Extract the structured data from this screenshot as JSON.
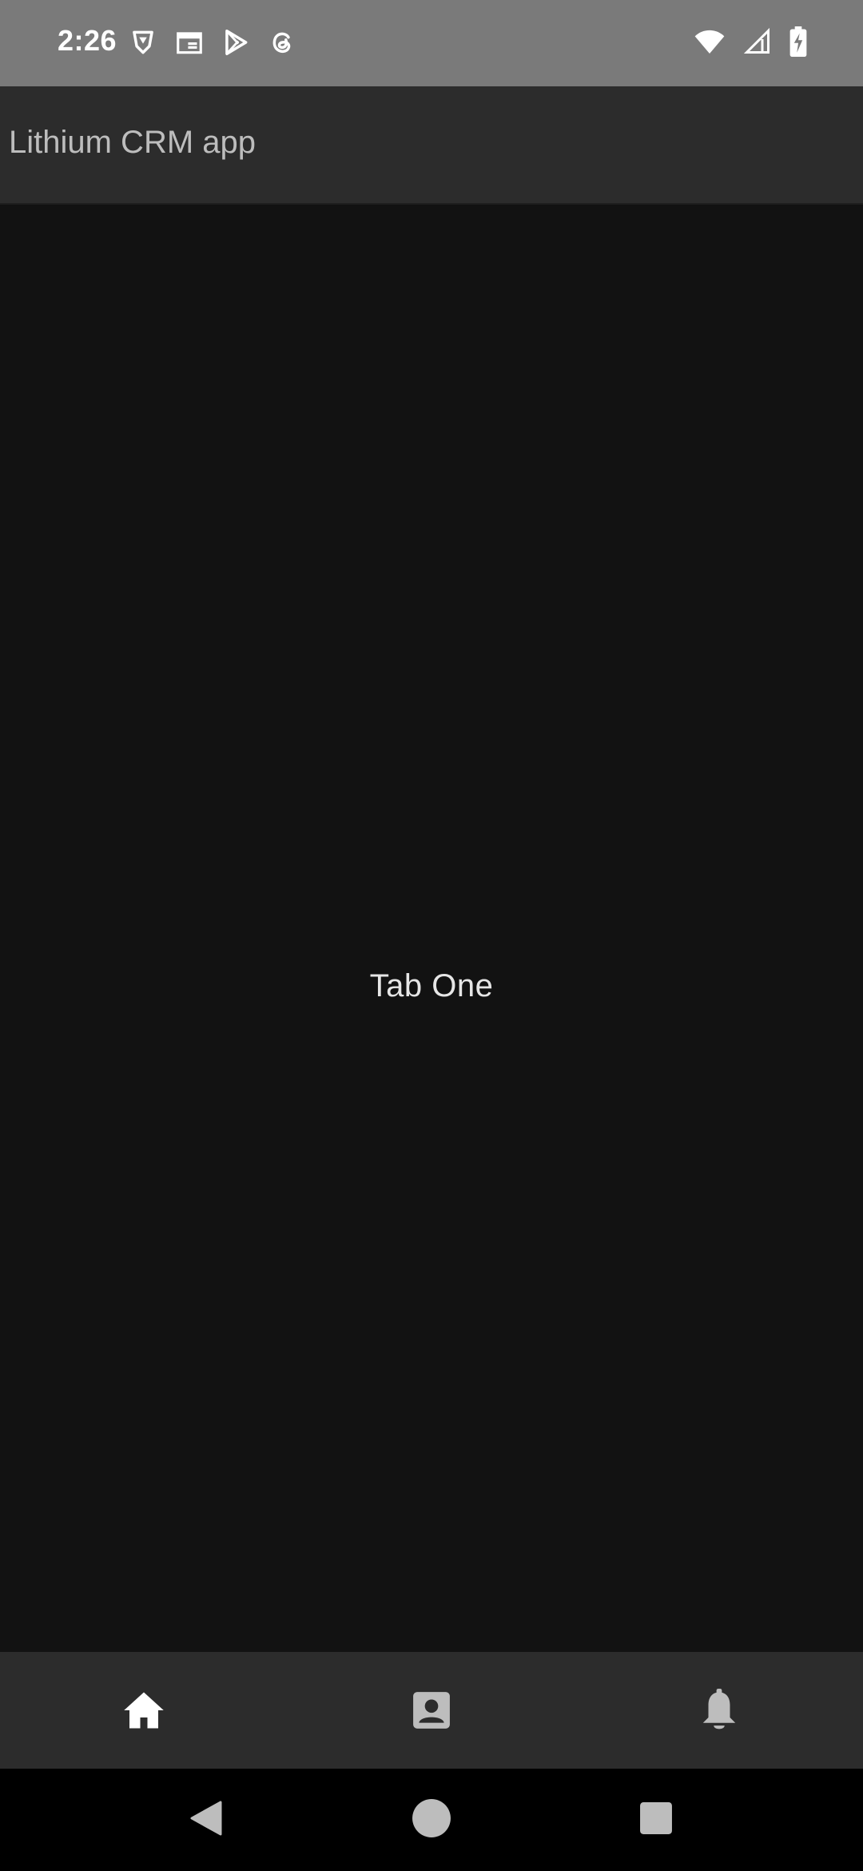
{
  "status_bar": {
    "time": "2:26",
    "left_icons": [
      "brave-shield-icon",
      "calendar-icon",
      "play-store-icon",
      "threads-icon"
    ],
    "right_icons": [
      "wifi-icon",
      "cellular-signal-icon",
      "battery-charging-icon"
    ]
  },
  "app_bar": {
    "title": "Lithium CRM app"
  },
  "main": {
    "tab_label": "Tab One"
  },
  "bottom_nav": {
    "items": [
      {
        "icon": "home-icon",
        "selected": true
      },
      {
        "icon": "contacts-icon",
        "selected": false
      },
      {
        "icon": "bell-icon",
        "selected": false
      }
    ]
  },
  "system_nav": {
    "buttons": [
      "back-icon",
      "home-circle-icon",
      "recents-icon"
    ]
  },
  "colors": {
    "status_bar_bg": "#7a7a7a",
    "app_bar_bg": "#2c2c2c",
    "content_bg": "#121212",
    "bottom_nav_bg": "#2c2c2c",
    "nav_selected": "#ffffff",
    "nav_unselected": "#bdbdbd"
  }
}
